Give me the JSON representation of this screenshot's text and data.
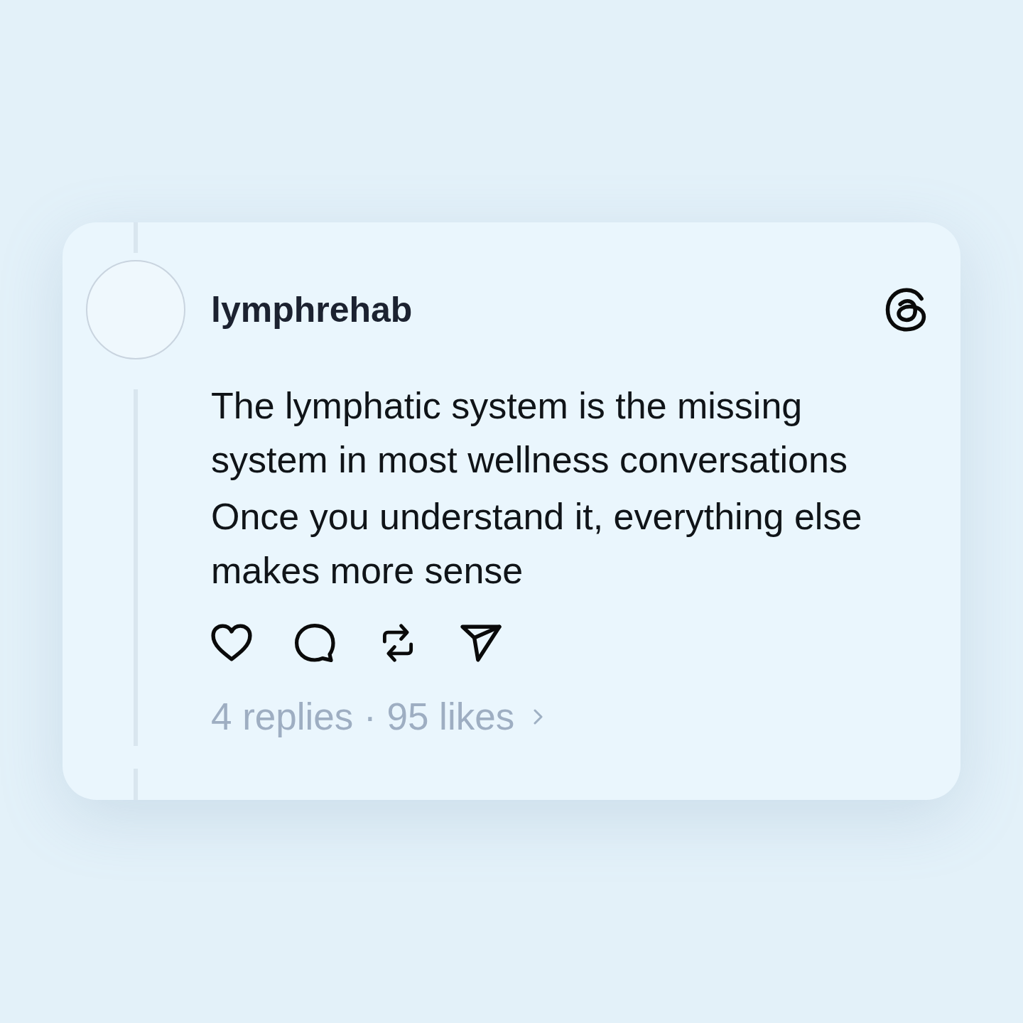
{
  "post": {
    "author": {
      "username": "lymphrehab"
    },
    "paragraphs": [
      "The lymphatic system is the missing system in most wellness conversations",
      "Once you understand it, everything else makes more sense"
    ],
    "stats": "4 replies · 95 likes"
  }
}
